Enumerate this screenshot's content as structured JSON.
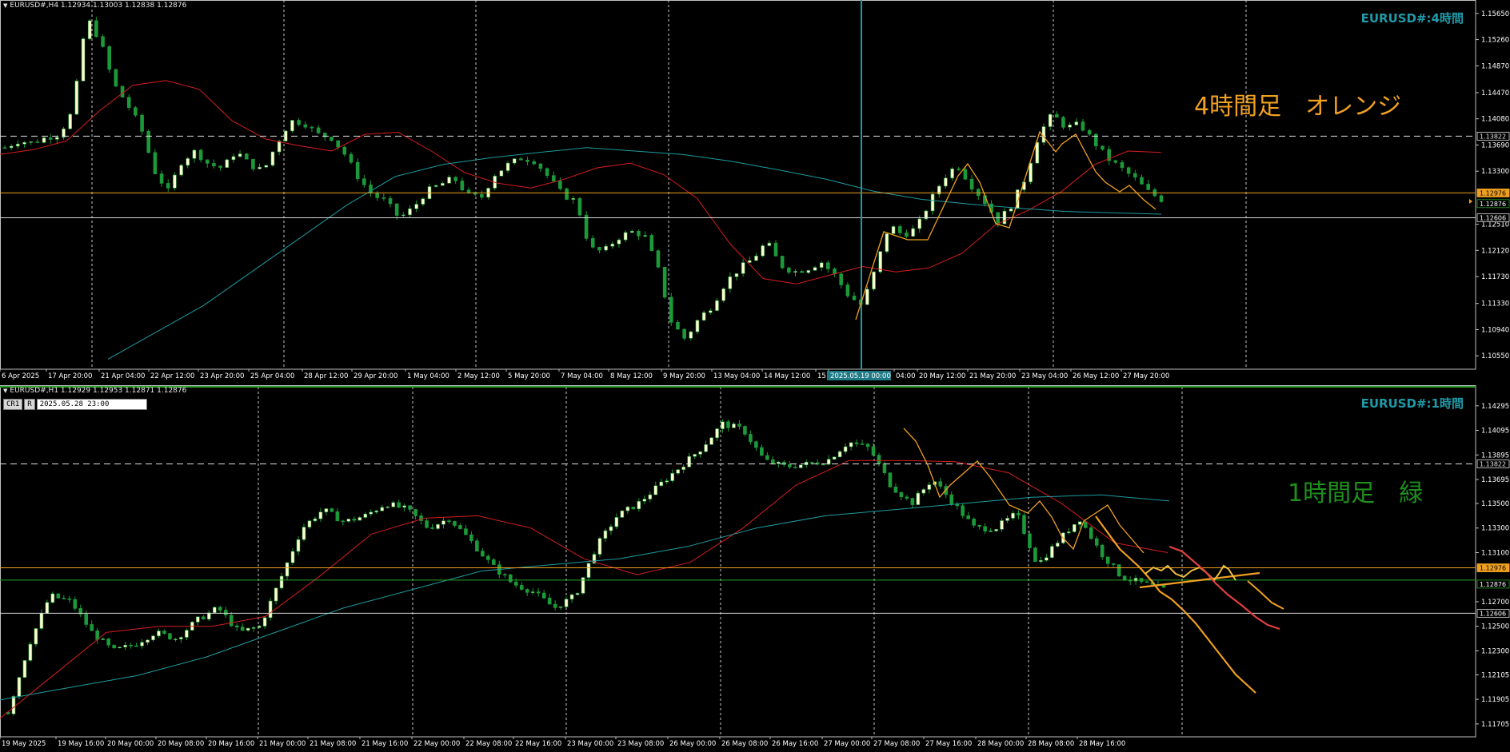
{
  "pane1": {
    "symbol_header": "EURUSD#,H4  1.12934 1.13003 1.12838 1.12876",
    "watermark": "EURUSD#:4時間",
    "annotation": "4時間足　オレンジ",
    "annotation_color": "#f0a020",
    "price_labels": [
      "1.15650",
      "1.15260",
      "1.14870",
      "1.14470",
      "1.14080",
      "1.13690",
      "1.13300",
      "1.12510",
      "1.12120",
      "1.11730",
      "1.11330",
      "1.10940",
      "1.10550"
    ],
    "hline_labels": [
      "1.13822",
      "1.12976",
      "1.12876",
      "1.12606"
    ],
    "time_labels": [
      "6 Apr 2025",
      "17 Apr 20:00",
      "21 Apr 04:00",
      "22 Apr 12:00",
      "23 Apr 20:00",
      "25 Apr 04:00",
      "28 Apr 12:00",
      "29 Apr 20:00",
      "1 May 04:00",
      "2 May 12:00",
      "5 May 20:00",
      "7 May 04:00",
      "8 May 12:00",
      "9 May 20:00",
      "13 May 04:00",
      "14 May 12:00",
      "15 M",
      "2025.05.19 00:00",
      "04:00",
      "20 May 12:00",
      "21 May 20:00",
      "23 May 04:00",
      "26 May 12:00",
      "27 May 20:00"
    ]
  },
  "pane2": {
    "symbol_header": "EURUSD#,H1  1.12929 1.12953 1.12871 1.12876",
    "watermark": "EURUSD#:1時間",
    "annotation": "1時間足　緑",
    "annotation_color": "#1e8f1e",
    "mini_buttons": [
      "CR1",
      "R"
    ],
    "cursor_datetime": "2025.05.28 23:00",
    "price_labels": [
      "1.14295",
      "1.14095",
      "1.13895",
      "1.13695",
      "1.13500",
      "1.13300",
      "1.13100",
      "1.12700",
      "1.12500",
      "1.12300",
      "1.12105",
      "1.11905",
      "1.11705"
    ],
    "hline_labels": [
      "1.13822",
      "1.12976",
      "1.12876",
      "1.12606"
    ],
    "time_labels": [
      "19 May 2025",
      "19 May 16:00",
      "20 May 00:00",
      "20 May 08:00",
      "20 May 16:00",
      "21 May 00:00",
      "21 May 08:00",
      "21 May 16:00",
      "22 May 00:00",
      "22 May 08:00",
      "22 May 16:00",
      "23 May 00:00",
      "23 May 08:00",
      "26 May 00:00",
      "26 May 08:00",
      "26 May 16:00",
      "27 May 00:00",
      "27 May 08:00",
      "27 May 16:00",
      "28 May 00:00",
      "28 May 08:00",
      "28 May 16:00"
    ]
  },
  "chart_data": [
    {
      "type": "candlestick",
      "title": "EURUSD#,H4",
      "ylim": [
        1.1035,
        1.1585
      ],
      "hlines": [
        1.13822,
        1.12976,
        1.12876,
        1.12606
      ],
      "close_path": [
        1.1365,
        1.1375,
        1.1372,
        1.138,
        1.1385,
        1.142,
        1.156,
        1.1525,
        1.146,
        1.143,
        1.1395,
        1.133,
        1.13,
        1.1345,
        1.136,
        1.134,
        1.1335,
        1.136,
        1.134,
        1.133,
        1.1372,
        1.1405,
        1.1402,
        1.1385,
        1.138,
        1.1355,
        1.132,
        1.1295,
        1.1285,
        1.126,
        1.1275,
        1.13,
        1.131,
        1.132,
        1.1295,
        1.129,
        1.1325,
        1.134,
        1.135,
        1.1345,
        1.132,
        1.1295,
        1.1285,
        1.1215,
        1.121,
        1.123,
        1.124,
        1.1235,
        1.1185,
        1.1105,
        1.108,
        1.111,
        1.113,
        1.1165,
        1.1185,
        1.12,
        1.1225,
        1.119,
        1.118,
        1.1185,
        1.1195,
        1.1175,
        1.1145,
        1.113,
        1.1185,
        1.125,
        1.1235,
        1.1245,
        1.1285,
        1.132,
        1.134,
        1.131,
        1.1285,
        1.1255,
        1.128,
        1.132,
        1.1385,
        1.1415,
        1.1395,
        1.14,
        1.1375,
        1.135,
        1.1335,
        1.132,
        1.13,
        1.1288
      ],
      "series": [
        {
          "name": "",
          "color": "#d71e1e",
          "values": [
            1.1355,
            1.1362,
            1.1375,
            1.142,
            1.1458,
            1.1465,
            1.1452,
            1.1405,
            1.1378,
            1.1368,
            1.136,
            1.1385,
            1.1388,
            1.136,
            1.1328,
            1.1312,
            1.1305,
            1.1318,
            1.1335,
            1.1342,
            1.1325,
            1.129,
            1.1222,
            1.117,
            1.1162,
            1.1175,
            1.1188,
            1.118,
            1.1186,
            1.1208,
            1.125,
            1.1272,
            1.13,
            1.134,
            1.136,
            1.1358
          ]
        },
        {
          "name": "",
          "color": "#1e9ba0",
          "values": [
            1.105,
            1.109,
            1.113,
            1.118,
            1.123,
            1.128,
            1.1322,
            1.134,
            1.135,
            1.1358,
            1.1365,
            1.136,
            1.1355,
            1.1345,
            1.1332,
            1.1318,
            1.13,
            1.1288,
            1.1281,
            1.1275,
            1.127,
            1.1268,
            1.1266
          ]
        }
      ]
    },
    {
      "type": "candlestick",
      "title": "EURUSD#,H1",
      "ylim": [
        1.116,
        1.1445
      ],
      "hlines": [
        1.13822,
        1.12976,
        1.12876,
        1.12606
      ],
      "close_path": [
        1.118,
        1.1235,
        1.1275,
        1.127,
        1.1245,
        1.123,
        1.1235,
        1.1245,
        1.124,
        1.1255,
        1.1265,
        1.1245,
        1.125,
        1.129,
        1.133,
        1.1345,
        1.1335,
        1.134,
        1.135,
        1.1345,
        1.133,
        1.1338,
        1.132,
        1.13,
        1.1285,
        1.1278,
        1.1265,
        1.1275,
        1.1315,
        1.134,
        1.135,
        1.1365,
        1.138,
        1.1395,
        1.1415,
        1.141,
        1.1385,
        1.138,
        1.1382,
        1.1385,
        1.14,
        1.1395,
        1.1365,
        1.135,
        1.137,
        1.135,
        1.133,
        1.133,
        1.1342,
        1.13,
        1.132,
        1.1338,
        1.131,
        1.129,
        1.1285,
        1.128
      ],
      "series": [
        {
          "name": "",
          "color": "#d71e1e",
          "values": [
            1.1175,
            1.121,
            1.1245,
            1.125,
            1.125,
            1.1258,
            1.129,
            1.1325,
            1.1338,
            1.134,
            1.133,
            1.1305,
            1.1292,
            1.1302,
            1.133,
            1.1365,
            1.1385,
            1.1385,
            1.1384,
            1.1375,
            1.135,
            1.1318,
            1.131
          ]
        },
        {
          "name": "",
          "color": "#1e9ba0",
          "values": [
            1.119,
            1.12,
            1.121,
            1.1225,
            1.1245,
            1.1265,
            1.128,
            1.1295,
            1.13,
            1.1305,
            1.1315,
            1.133,
            1.134,
            1.1345,
            1.135,
            1.1355,
            1.1357,
            1.1352
          ]
        }
      ]
    }
  ]
}
